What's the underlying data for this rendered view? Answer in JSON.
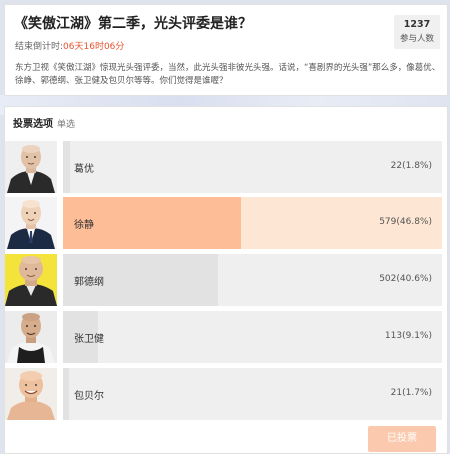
{
  "poll": {
    "title": "《笑傲江湖》第二季，光头评委是谁？",
    "deadline_label": "结束倒计时:",
    "deadline_time": "06天16时06分",
    "participants_count": "1237",
    "participants_label": "参与人数",
    "description": "东方卫视《笑傲江湖》惊现光头强评委，当然，此光头强非彼光头强。话说，“喜剧界的光头强”那么多，像葛优、徐峥、郭德纲、张卫健及包贝尔等等。你们觉得是谁喔？"
  },
  "vote": {
    "header": "投票选项",
    "type": "单选",
    "options": [
      {
        "name": "葛优",
        "count": "22",
        "percent": "(1.8%)",
        "share": 0.018,
        "selected": false
      },
      {
        "name": "徐静",
        "count": "579",
        "percent": "(46.8%)",
        "share": 0.468,
        "selected": true
      },
      {
        "name": "郭德纲",
        "count": "502",
        "percent": "(40.6%)",
        "share": 0.406,
        "selected": false
      },
      {
        "name": "张卫健",
        "count": "113",
        "percent": "(9.1%)",
        "share": 0.091,
        "selected": false
      },
      {
        "name": "包贝尔",
        "count": "21",
        "percent": "(1.7%)",
        "share": 0.017,
        "selected": false
      }
    ],
    "voted_button": "已投票"
  },
  "colors": {
    "countdown": "#e8522f",
    "selected_fill": "#fdbd97",
    "selected_track": "#fde6d3",
    "default_fill": "#e2e2e2",
    "button": "#fbc9ad"
  }
}
